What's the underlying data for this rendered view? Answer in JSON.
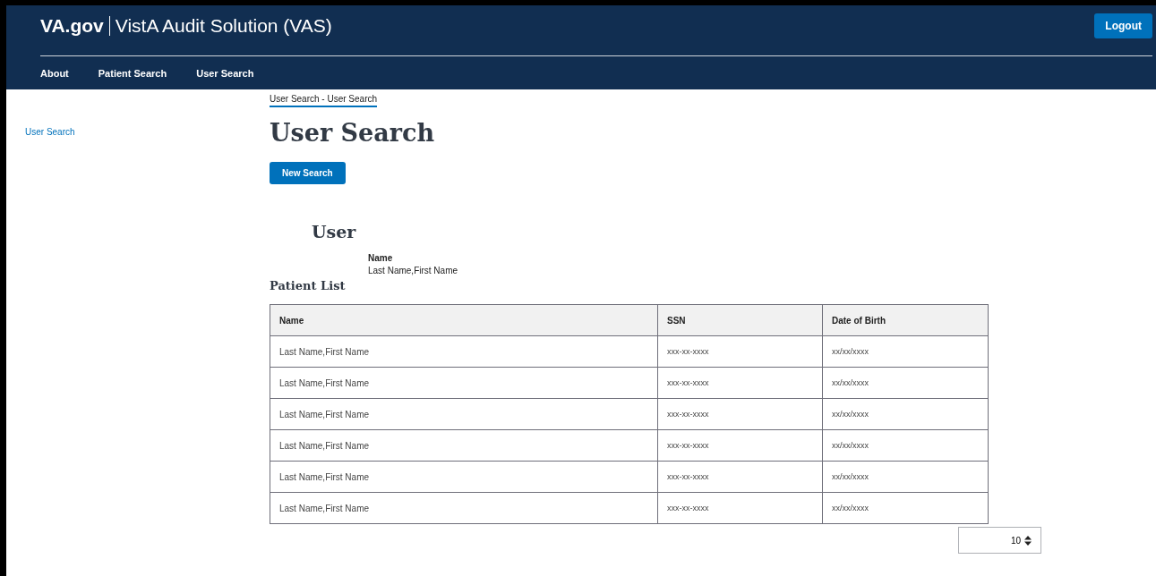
{
  "header": {
    "brand": "VA.gov",
    "title": "VistA Audit Solution (VAS)",
    "logout": "Logout"
  },
  "nav": [
    "About",
    "Patient Search",
    "User Search"
  ],
  "sidebar": {
    "items": [
      "User Search"
    ]
  },
  "breadcrumb": "User Search - User Search",
  "page_title": "User Search",
  "new_search": "New Search",
  "user": {
    "heading": "User",
    "label": "Name",
    "value": "Last Name,First Name"
  },
  "patient_list": {
    "heading": "Patient List",
    "columns": [
      "Name",
      "SSN",
      "Date of Birth"
    ],
    "rows": [
      [
        "Last Name,First Name",
        "xxx-xx-xxxx",
        "xx/xx/xxxx"
      ],
      [
        "Last Name,First Name",
        "xxx-xx-xxxx",
        "xx/xx/xxxx"
      ],
      [
        "Last Name,First Name",
        "xxx-xx-xxxx",
        "xx/xx/xxxx"
      ],
      [
        "Last Name,First Name",
        "xxx-xx-xxxx",
        "xx/xx/xxxx"
      ],
      [
        "Last Name,First Name",
        "xxx-xx-xxxx",
        "xx/xx/xxxx"
      ],
      [
        "Last Name,First Name",
        "xxx-xx-xxxx",
        "xx/xx/xxxx"
      ]
    ]
  },
  "page_size": "10"
}
